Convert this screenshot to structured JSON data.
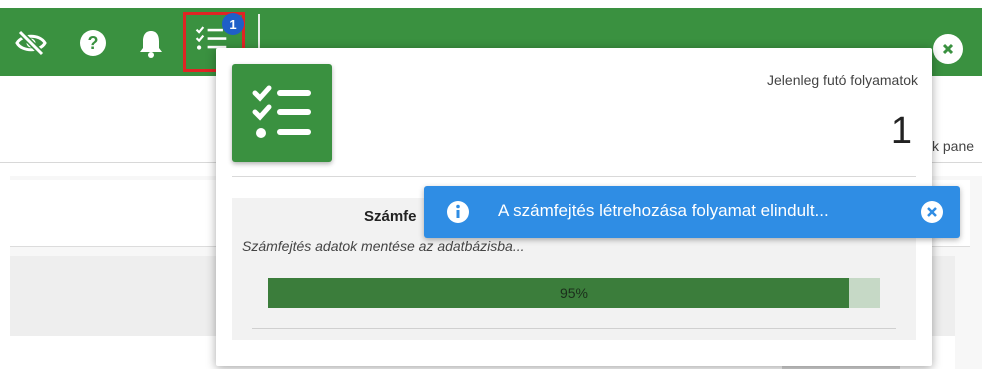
{
  "header": {
    "task_badge_count": "1",
    "colors": {
      "bar": "#3a9140",
      "highlight": "#e02424",
      "badge": "#1f5fc8"
    },
    "icons": [
      "eye-off-icon",
      "help-icon",
      "bell-icon",
      "task-list-icon",
      "close-icon"
    ]
  },
  "background": {
    "panel_label": "k pane"
  },
  "tasks_popup": {
    "title": "Jelenleg futó folyamatok",
    "count": "1",
    "process": {
      "title": "Számfe",
      "description": "Számfejtés adatok mentése az adatbázisba...",
      "progress_percent": 95,
      "progress_label": "95%"
    }
  },
  "toast": {
    "message": "A számfejtés létrehozása folyamat elindult...",
    "color": "#2f8de4"
  }
}
